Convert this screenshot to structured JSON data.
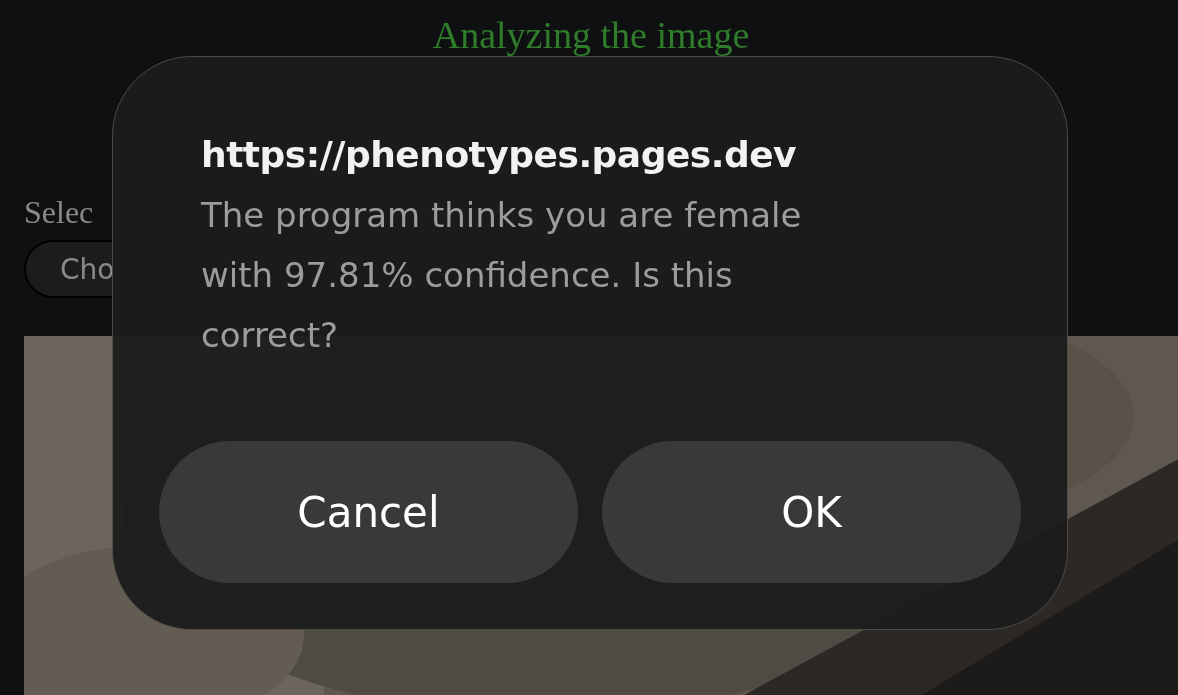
{
  "page": {
    "heading": "Analyzing the image",
    "select_label": "Selec",
    "choose_button": "Cho"
  },
  "dialog": {
    "title": "https://phenotypes.pages.dev",
    "message": "The program thinks you are female with 97.81% confidence. Is this correct?",
    "buttons": [
      "Cancel",
      "OK"
    ]
  }
}
